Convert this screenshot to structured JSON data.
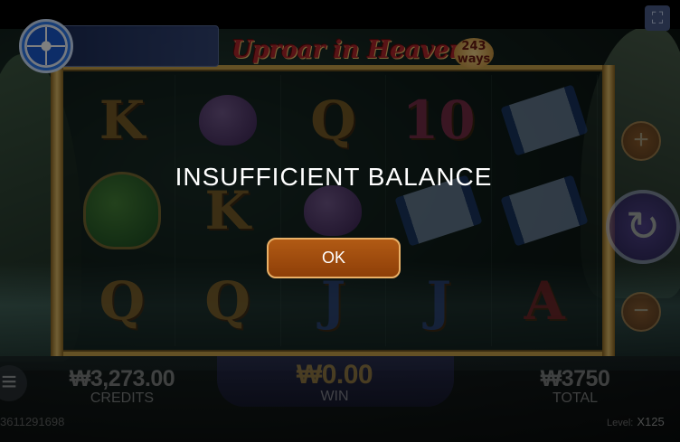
{
  "game": {
    "logo_title": "Uproar in Heaven",
    "logo_badge": "243 ways"
  },
  "reels": [
    [
      "K",
      "peach",
      "Q",
      "10",
      "scroll"
    ],
    [
      "jar",
      "K",
      "peach",
      "scroll",
      "scroll"
    ],
    [
      "Q",
      "Q",
      "J",
      "J",
      "A"
    ]
  ],
  "side_controls": {
    "plus_label": "+",
    "minus_label": "−",
    "spin_icon": "↻"
  },
  "menu": {
    "hamburger_icon": "≡"
  },
  "fullscreen_icon": "⛶",
  "stats": {
    "credits_value": "₩3,273.00",
    "credits_label": "CREDITS",
    "win_value": "₩0.00",
    "win_label": "WIN",
    "total_value": "₩3750",
    "total_label": "TOTAL"
  },
  "player_id": "3611291698",
  "level": {
    "label": "Level:",
    "value": "X125"
  },
  "modal": {
    "message": "INSUFFICIENT BALANCE",
    "ok_label": "OK"
  },
  "colors": {
    "ok_button": "#a34c0f",
    "frame_gold": "#c9a24a",
    "win_gold": "#f1c24a"
  }
}
